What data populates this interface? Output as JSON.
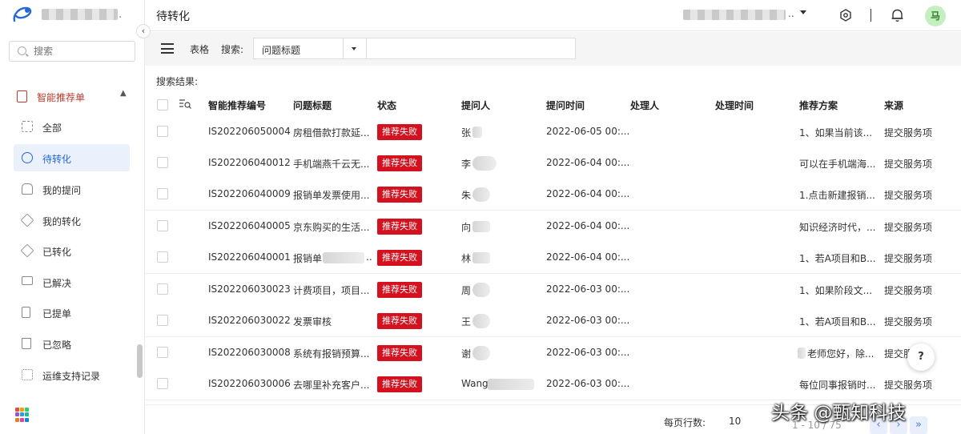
{
  "sidebar": {
    "search_placeholder": "搜索",
    "group": {
      "label": "智能推荐单"
    },
    "items": [
      {
        "label": "全部",
        "icon": "grid-icon"
      },
      {
        "label": "待转化",
        "icon": "clock-icon",
        "active": true
      },
      {
        "label": "我的提问",
        "icon": "hand-icon"
      },
      {
        "label": "我的转化",
        "icon": "cube-icon"
      },
      {
        "label": "已转化",
        "icon": "cube-check-icon"
      },
      {
        "label": "已解决",
        "icon": "monitor-icon"
      },
      {
        "label": "已提单",
        "icon": "document-icon"
      },
      {
        "label": "已忽略",
        "icon": "trash-icon"
      },
      {
        "label": "运维支持记录",
        "icon": "list-check-icon"
      }
    ]
  },
  "header": {
    "title": "待转化",
    "user_suffix": "..",
    "avatar_text": "马"
  },
  "toolbar": {
    "view_label": "表格",
    "search_label": "搜索:",
    "field_value": "问题标题",
    "query_value": ""
  },
  "results_label": "搜索结果:",
  "table": {
    "columns": [
      "智能推荐编号",
      "问题标题",
      "状态",
      "提问人",
      "提问时间",
      "处理人",
      "处理时间",
      "推荐方案",
      "来源"
    ],
    "rows": [
      {
        "id": "IS202206050004",
        "title": "房租借款打款延...",
        "status": "推荐失败",
        "asker": "张",
        "time": "2022-06-05 00:...",
        "handler": "",
        "handle_time": "",
        "solution": "1、如果当前该...",
        "source": "提交服务项"
      },
      {
        "id": "IS202206040012",
        "title": "手机端燕千云无...",
        "status": "推荐失败",
        "asker": "李",
        "time": "2022-06-04 00:...",
        "handler": "",
        "handle_time": "",
        "solution": "可以在手机端海...",
        "source": "提交服务项"
      },
      {
        "id": "IS202206040009",
        "title": "报销单发票使用...",
        "status": "推荐失败",
        "asker": "朱",
        "time": "2022-06-04 00:...",
        "handler": "",
        "handle_time": "",
        "solution": "1.点击新建报销...",
        "source": "提交服务项"
      },
      {
        "id": "IS202206040005",
        "title": "京东购买的生活...",
        "status": "推荐失败",
        "asker": "向",
        "time": "2022-06-04 00:...",
        "handler": "",
        "handle_time": "",
        "solution": "知识经济时代，...",
        "source": "提交服务项"
      },
      {
        "id": "IS202206040001",
        "title": "报销单",
        "status": "推荐失败",
        "asker": "林",
        "time": "2022-06-04 00:...",
        "handler": "",
        "handle_time": "",
        "solution": "1、若A项目和B...",
        "source": "提交服务项"
      },
      {
        "id": "IS202206030023",
        "title": "计费项目，项目...",
        "status": "推荐失败",
        "asker": "周",
        "time": "2022-06-03 00:...",
        "handler": "",
        "handle_time": "",
        "solution": "1、如果阶段文...",
        "source": "提交服务项"
      },
      {
        "id": "IS202206030022",
        "title": "发票审核",
        "status": "推荐失败",
        "asker": "王",
        "time": "2022-06-03 00:...",
        "handler": "",
        "handle_time": "",
        "solution": "1、若A项目和B...",
        "source": "提交服务项"
      },
      {
        "id": "IS202206030008",
        "title": "系统有报销预算...",
        "status": "推荐失败",
        "asker": "谢",
        "time": "2022-06-03 00:...",
        "handler": "",
        "handle_time": "",
        "solution": "老师您好，除...",
        "source": "提交服"
      },
      {
        "id": "IS202206030006",
        "title": "去哪里补充客户...",
        "status": "推荐失败",
        "asker": "Wang",
        "time": "2022-06-03 00:...",
        "handler": "",
        "handle_time": "",
        "solution": "每位同事报销时...",
        "source": "提交服务项"
      }
    ]
  },
  "footer": {
    "rows_per_page_label": "每页行数:",
    "rows_per_page": "10",
    "range": "1 - 10 / 75"
  },
  "watermark": "头条 @甄知科技",
  "colors": {
    "accent": "#2469d6",
    "danger": "#d4111e",
    "group": "#c0392b"
  }
}
